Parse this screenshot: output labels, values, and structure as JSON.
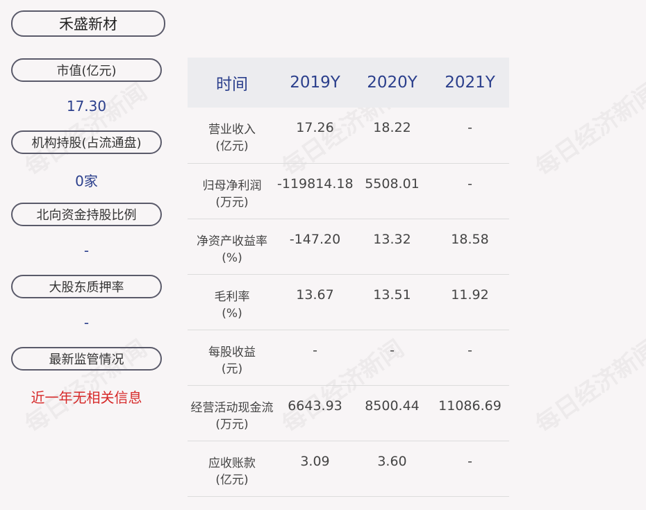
{
  "company": "禾盛新材",
  "left_panel": [
    {
      "label": "市值(亿元)",
      "value": "17.30"
    },
    {
      "label": "机构持股(占流通盘)",
      "value": "0家"
    },
    {
      "label": "北向资金持股比例",
      "value": "-"
    },
    {
      "label": "大股东质押率",
      "value": "-"
    },
    {
      "label": "最新监管情况",
      "value": "近一年无相关信息"
    }
  ],
  "table": {
    "headers": [
      "时间",
      "2019Y",
      "2020Y",
      "2021Y"
    ],
    "rows": [
      {
        "label_line1": "营业收入",
        "label_line2": "(亿元)",
        "values": [
          "17.26",
          "18.22",
          "-"
        ]
      },
      {
        "label_line1": "归母净利润",
        "label_line2": "(万元)",
        "values": [
          "-119814.18",
          "5508.01",
          "-"
        ]
      },
      {
        "label_line1": "净资产收益率",
        "label_line2": "(%)",
        "values": [
          "-147.20",
          "13.32",
          "18.58"
        ]
      },
      {
        "label_line1": "毛利率",
        "label_line2": "(%)",
        "values": [
          "13.67",
          "13.51",
          "11.92"
        ]
      },
      {
        "label_line1": "每股收益",
        "label_line2": "(元)",
        "values": [
          "-",
          "-",
          "-"
        ]
      },
      {
        "label_line1": "经营活动现金流",
        "label_line2": "(万元)",
        "values": [
          "6643.93",
          "8500.44",
          "11086.69"
        ]
      },
      {
        "label_line1": "应收账款",
        "label_line2": "(亿元)",
        "values": [
          "3.09",
          "3.60",
          "-"
        ]
      }
    ]
  },
  "watermark_text": "每日经济新闻",
  "colors": {
    "value_blue": "#2b3f8c",
    "alert_red": "#d62a2a",
    "header_bg": "#ececef"
  }
}
